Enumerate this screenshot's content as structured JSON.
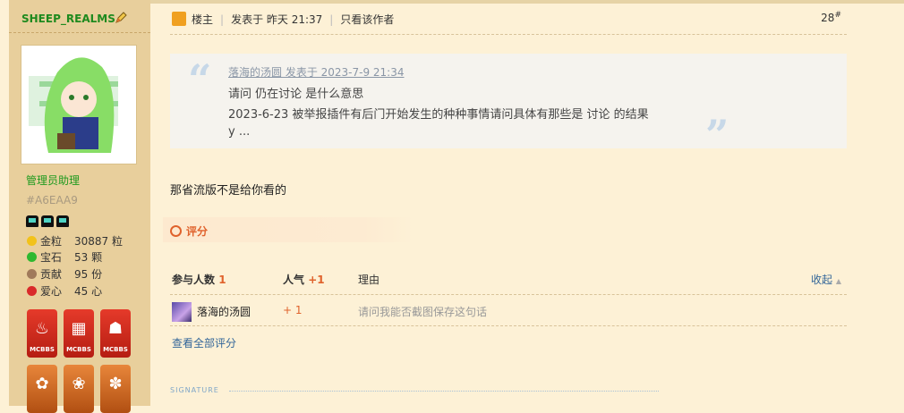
{
  "user": {
    "name": "SHEEP_REALMS",
    "role": "管理员助理",
    "uid": "#A6EAA9",
    "stats": [
      {
        "label": "金粒",
        "value": "30887 粒",
        "color": "#f2c21a"
      },
      {
        "label": "宝石",
        "value": "53 颗",
        "color": "#2fb82f"
      },
      {
        "label": "贡献",
        "value": "95 份",
        "color": "#a07a5a"
      },
      {
        "label": "爱心",
        "value": "45 心",
        "color": "#d92a2a"
      }
    ],
    "medals": [
      {
        "label": "MCBBS"
      },
      {
        "label": "MCBBS"
      },
      {
        "label": "MCBBS"
      }
    ]
  },
  "post": {
    "lz_label": "楼主",
    "posted": "发表于 昨天 21:37",
    "only_author": "只看该作者",
    "floor": "28",
    "floor_sup": "#",
    "quote": {
      "meta": "落海的汤圆 发表于 2023-7-9 21:34",
      "lines": [
        "请问 仍在讨论 是什么意思",
        "2023-6-23 被举报插件有后门开始发生的种种事情请问具体有那些是 讨论 的结果",
        "y ..."
      ]
    },
    "reply": "那省流版不是给你看的"
  },
  "rating": {
    "button": "评分",
    "headers": {
      "participants": "参与人数",
      "participants_count": "1",
      "popularity": "人气",
      "popularity_value": "+1",
      "reason": "理由",
      "collapse": "收起"
    },
    "rows": [
      {
        "user": "落海的汤圆",
        "score": "+ 1",
        "reason": "请问我能否截图保存这句话"
      }
    ],
    "view_all": "查看全部评分"
  },
  "signature_label": "SIGNATURE"
}
